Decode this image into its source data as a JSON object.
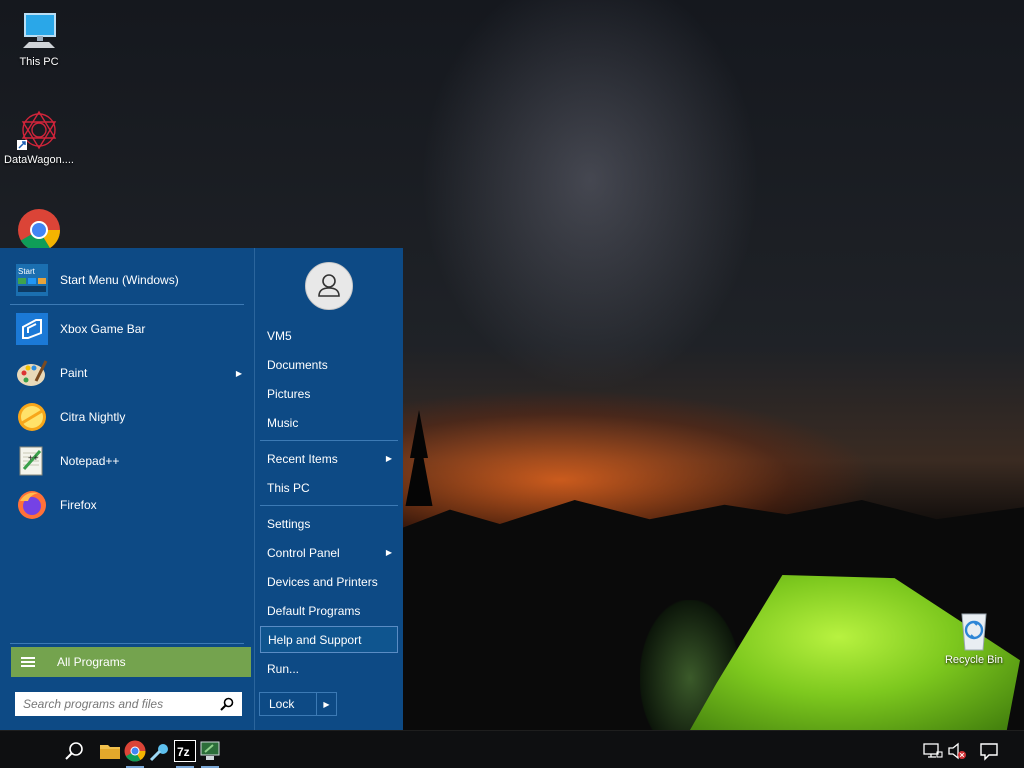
{
  "desktop": {
    "icons": [
      {
        "label": "This PC",
        "icon": "monitor-icon"
      },
      {
        "label": "DataWagon....",
        "icon": "datawagon-icon"
      },
      {
        "label": "",
        "icon": "chrome-icon"
      },
      {
        "label": "Recycle Bin",
        "icon": "recycle-bin-icon"
      }
    ]
  },
  "start_menu": {
    "pinned": [
      {
        "label": "Start Menu (Windows)",
        "icon": "start-menu-icon",
        "has_submenu": false
      }
    ],
    "recent": [
      {
        "label": "Xbox Game Bar",
        "icon": "xbox-game-bar-icon",
        "has_submenu": false
      },
      {
        "label": "Paint",
        "icon": "paint-palette-icon",
        "has_submenu": true
      },
      {
        "label": "Citra Nightly",
        "icon": "citra-icon",
        "has_submenu": false
      },
      {
        "label": "Notepad++",
        "icon": "notepadpp-icon",
        "has_submenu": false
      },
      {
        "label": "Firefox",
        "icon": "firefox-icon",
        "has_submenu": false
      }
    ],
    "all_programs_label": "All Programs",
    "search_placeholder": "Search programs and files",
    "right": {
      "user_items": [
        "VM5",
        "Documents",
        "Pictures",
        "Music"
      ],
      "recent_items": [
        {
          "label": "Recent Items",
          "has_submenu": true
        },
        {
          "label": "This PC",
          "has_submenu": false
        }
      ],
      "system_items": [
        {
          "label": "Settings",
          "has_submenu": false
        },
        {
          "label": "Control Panel",
          "has_submenu": true
        },
        {
          "label": "Devices and Printers",
          "has_submenu": false
        },
        {
          "label": "Default Programs",
          "has_submenu": false
        },
        {
          "label": "Help and Support",
          "has_submenu": false,
          "highlighted": true
        },
        {
          "label": "Run...",
          "has_submenu": false
        }
      ],
      "lock_label": "Lock"
    }
  },
  "taskbar": {
    "icons": [
      "search-icon",
      "file-explorer-icon",
      "chrome-icon",
      "comet-icon",
      "7zip-icon",
      "remote-desktop-icon"
    ],
    "tray": [
      "network-icon",
      "volume-muted-icon",
      "notification-icon"
    ]
  },
  "colors": {
    "menu_bg": "#0d4a85",
    "all_programs_bg": "#74a34e",
    "taskbar_bg": "#0e0f11"
  }
}
